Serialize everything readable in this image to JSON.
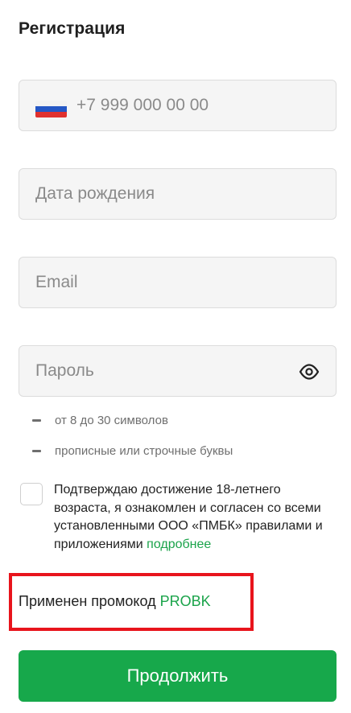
{
  "form": {
    "title": "Регистрация",
    "phone": {
      "placeholder": "+7 999 000 00 00",
      "value": "",
      "country_flag": "russia-flag-icon"
    },
    "birth_date": {
      "placeholder": "Дата рождения",
      "value": ""
    },
    "email": {
      "placeholder": "Email",
      "value": ""
    },
    "password": {
      "placeholder": "Пароль",
      "value": "",
      "toggle_icon": "eye-icon"
    },
    "password_hints": [
      "от 8 до 30 символов",
      "прописные или строчные буквы"
    ],
    "consent": {
      "checked": false,
      "text": "Подтверждаю достижение 18-летнего возраста, я ознакомлен и согласен со всеми установленными ООО «ПМБК» правилами и приложениями",
      "link": "подробнее"
    },
    "promo": {
      "label": "Применен промокод",
      "code": "PROBK"
    },
    "submit_label": "Продолжить"
  },
  "colors": {
    "accent_green": "#17a84b",
    "link_green": "#1aa34a",
    "highlight_red": "#e8141c",
    "field_bg": "#f5f5f5"
  }
}
